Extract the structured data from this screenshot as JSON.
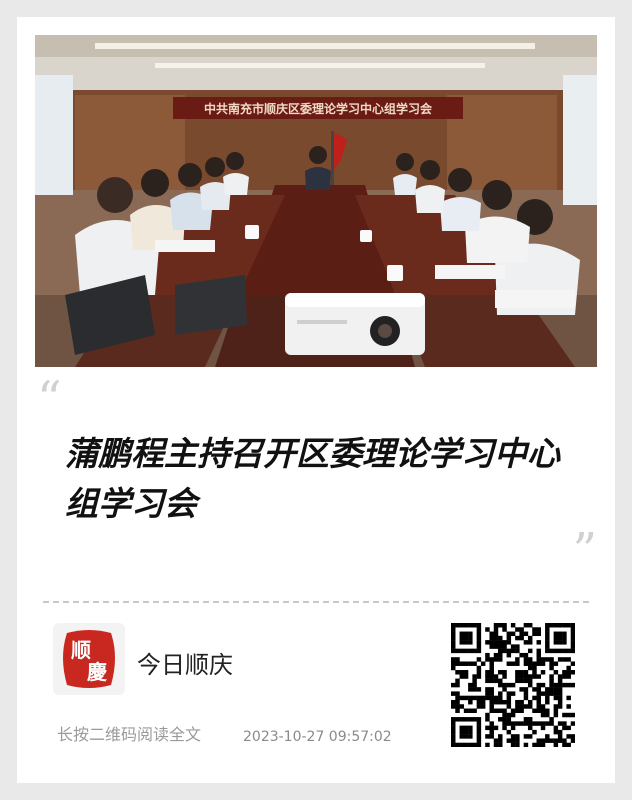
{
  "photo": {
    "banner_text": "中共南充市顺庆区委理论学习中心组学习会"
  },
  "article": {
    "quote_open": "“",
    "quote_close": "”",
    "headline": "蒲鹏程主持召开区委理论学习中心组学习会"
  },
  "footer": {
    "logo_text_top": "顺",
    "logo_text_bottom": "慶",
    "source_name": "今日顺庆",
    "hint": "长按二维码阅读全文",
    "timestamp": "2023-10-27 09:57:02"
  },
  "colors": {
    "background": "#e9e9e9",
    "card": "#ffffff",
    "banner_red": "#b3201c",
    "logo_red": "#c8281f"
  }
}
